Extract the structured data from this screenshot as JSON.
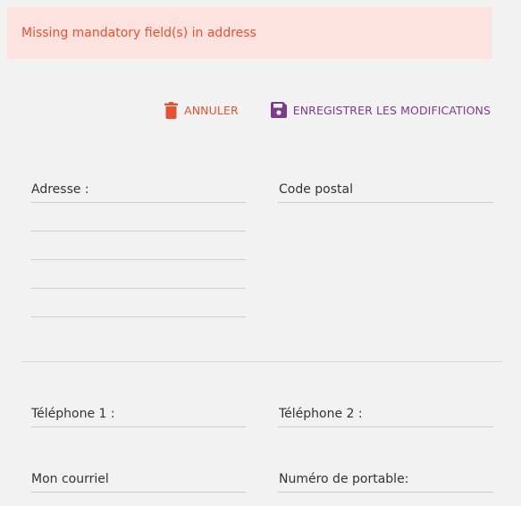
{
  "alert": {
    "message": "Missing mandatory field(s) in address",
    "color": "#e8512f",
    "background": "#fde3df"
  },
  "toolbar": {
    "cancel_label": "ANNULER",
    "cancel_icon": "trash-icon",
    "save_label": "ENREGISTRER LES MODIFICATIONS",
    "save_icon": "save-icon",
    "cancel_color": "#e8512f",
    "save_color": "#7d3b8b"
  },
  "address": {
    "address_label": "Adresse :",
    "postal_code_label": "Code postal"
  },
  "contact": {
    "phone1_label": "Téléphone 1 :",
    "phone2_label": "Téléphone 2 :",
    "email_label": "Mon courriel",
    "mobile_label": "Numéro de portable:"
  }
}
